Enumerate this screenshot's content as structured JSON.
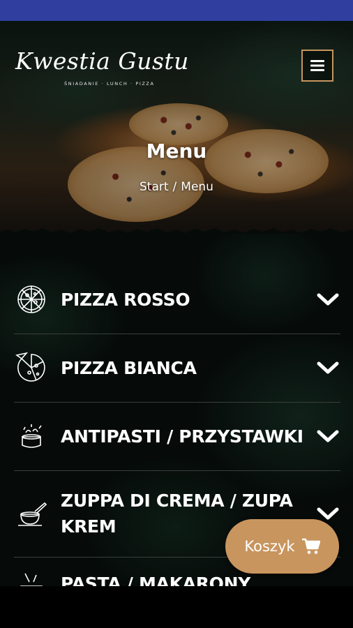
{
  "logo": {
    "title": "Kwestia Gustu",
    "tagline": "ŚNIADANIE · LUNCH · PIZZA"
  },
  "header": {
    "menu_icon": "hamburger-icon"
  },
  "page": {
    "title": "Menu"
  },
  "breadcrumb": {
    "home": "Start",
    "separator": "/",
    "current": "Menu"
  },
  "menu": {
    "items": [
      {
        "label": "PIZZA ROSSO",
        "icon": "pizza-icon"
      },
      {
        "label": "PIZZA BIANCA",
        "icon": "pizza-icon"
      },
      {
        "label": "ANTIPASTI / PRZYSTAWKI",
        "icon": "appetizer-icon"
      },
      {
        "label": "ZUPPA DI CREMA / ZUPA KREM",
        "icon": "soup-icon"
      },
      {
        "label": "PASTA / MAKARONY",
        "icon": "pasta-icon"
      }
    ]
  },
  "cart": {
    "label": "Koszyk",
    "icon": "cart-icon"
  },
  "colors": {
    "accent": "#c8955e",
    "status_bar": "#303f9f",
    "background": "#000000"
  }
}
